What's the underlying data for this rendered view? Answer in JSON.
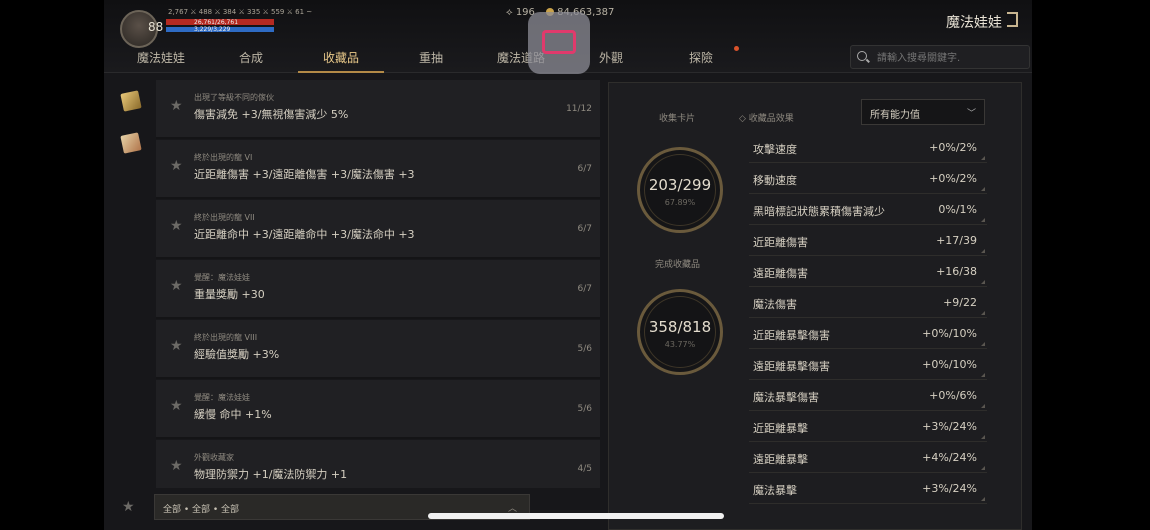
{
  "player": {
    "level": "88",
    "stat_strip": "2,767  ⚔ 488  ⚔ 384  ⚔ 335  ⚔ 559  ⚔ 61 ~",
    "hp_text": "26,761/26,761",
    "mp_text": "3,229/3,229",
    "hp_fraction": 1.0,
    "mp_fraction": 1.0
  },
  "currency": {
    "gems": "196",
    "gold": "84,663,387"
  },
  "app_title": "魔法娃娃",
  "tabs": [
    {
      "label": "魔法娃娃"
    },
    {
      "label": "合成"
    },
    {
      "label": "收藏品"
    },
    {
      "label": "重抽"
    },
    {
      "label": "魔法道路"
    },
    {
      "label": "外觀"
    },
    {
      "label": "探險"
    }
  ],
  "search": {
    "placeholder": "請輸入搜尋關鍵字."
  },
  "collection_list": [
    {
      "title": "出現了等級不同的傢伙",
      "desc": "傷害減免 +3/無視傷害減少 5%",
      "count": "11/12"
    },
    {
      "title": "終於出現的龍 VI",
      "desc": "近距離傷害 +3/遠距離傷害 +3/魔法傷害 +3",
      "count": "6/7"
    },
    {
      "title": "終於出現的龍 VII",
      "desc": "近距離命中 +3/遠距離命中 +3/魔法命中 +3",
      "count": "6/7"
    },
    {
      "title": "覺醒：魔法娃娃",
      "desc": "重量獎勵 +30",
      "count": "6/7"
    },
    {
      "title": "終於出現的龍 VIII",
      "desc": "經驗值獎勵 +3%",
      "count": "5/6"
    },
    {
      "title": "覺醒：魔法娃娃",
      "desc": "緩慢 命中 +1%",
      "count": "5/6"
    },
    {
      "title": "外觀收藏家",
      "desc": "物理防禦力 +1/魔法防禦力 +1",
      "count": "4/5"
    }
  ],
  "filter": {
    "label": "全部 • 全部 • 全部"
  },
  "summary": {
    "cards_label": "收集卡片",
    "cards_value": "203/299",
    "cards_pct": "67.89%",
    "done_label": "完成收藏品",
    "done_value": "358/818",
    "done_pct": "43.77%",
    "effects_label": "◇ 收藏品效果",
    "dropdown_value": "所有能力值"
  },
  "stats": [
    {
      "name": "攻擊速度",
      "value": "+0%/2%"
    },
    {
      "name": "移動速度",
      "value": "+0%/2%"
    },
    {
      "name": "黑暗標記狀態累積傷害減少",
      "value": "0%/1%"
    },
    {
      "name": "近距離傷害",
      "value": "+17/39"
    },
    {
      "name": "遠距離傷害",
      "value": "+16/38"
    },
    {
      "name": "魔法傷害",
      "value": "+9/22"
    },
    {
      "name": "近距離暴擊傷害",
      "value": "+0%/10%"
    },
    {
      "name": "遠距離暴擊傷害",
      "value": "+0%/10%"
    },
    {
      "name": "魔法暴擊傷害",
      "value": "+0%/6%"
    },
    {
      "name": "近距離暴擊",
      "value": "+3%/24%"
    },
    {
      "name": "遠距離暴擊",
      "value": "+4%/24%"
    },
    {
      "name": "魔法暴擊",
      "value": "+3%/24%"
    }
  ]
}
